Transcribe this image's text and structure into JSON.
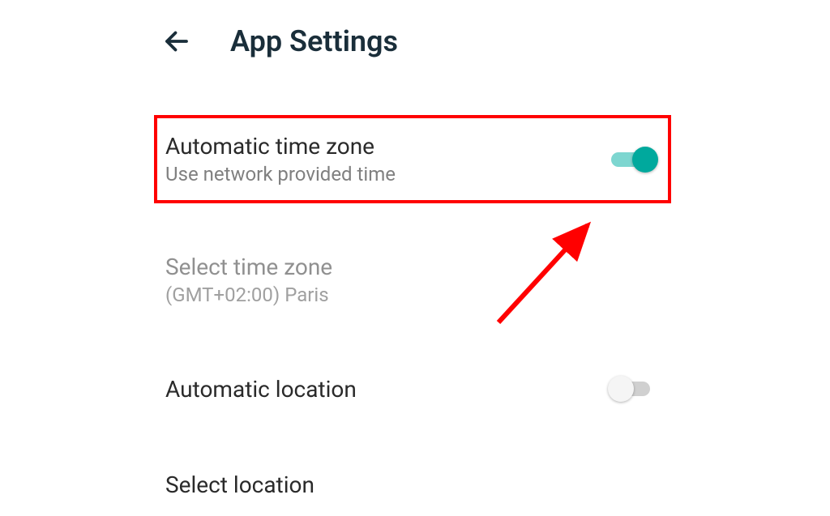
{
  "header": {
    "title": "App Settings"
  },
  "settings": {
    "auto_timezone": {
      "title": "Automatic time zone",
      "subtitle": "Use network provided time",
      "enabled": true
    },
    "select_timezone": {
      "title": "Select time zone",
      "subtitle": "(GMT+02:00) Paris"
    },
    "auto_location": {
      "title": "Automatic location",
      "enabled": false
    },
    "select_location": {
      "title": "Select location"
    }
  },
  "colors": {
    "highlight_border": "#ff0000",
    "toggle_on": "#00a99d",
    "toggle_on_track": "#7dd6d0",
    "arrow": "#ff0000"
  }
}
